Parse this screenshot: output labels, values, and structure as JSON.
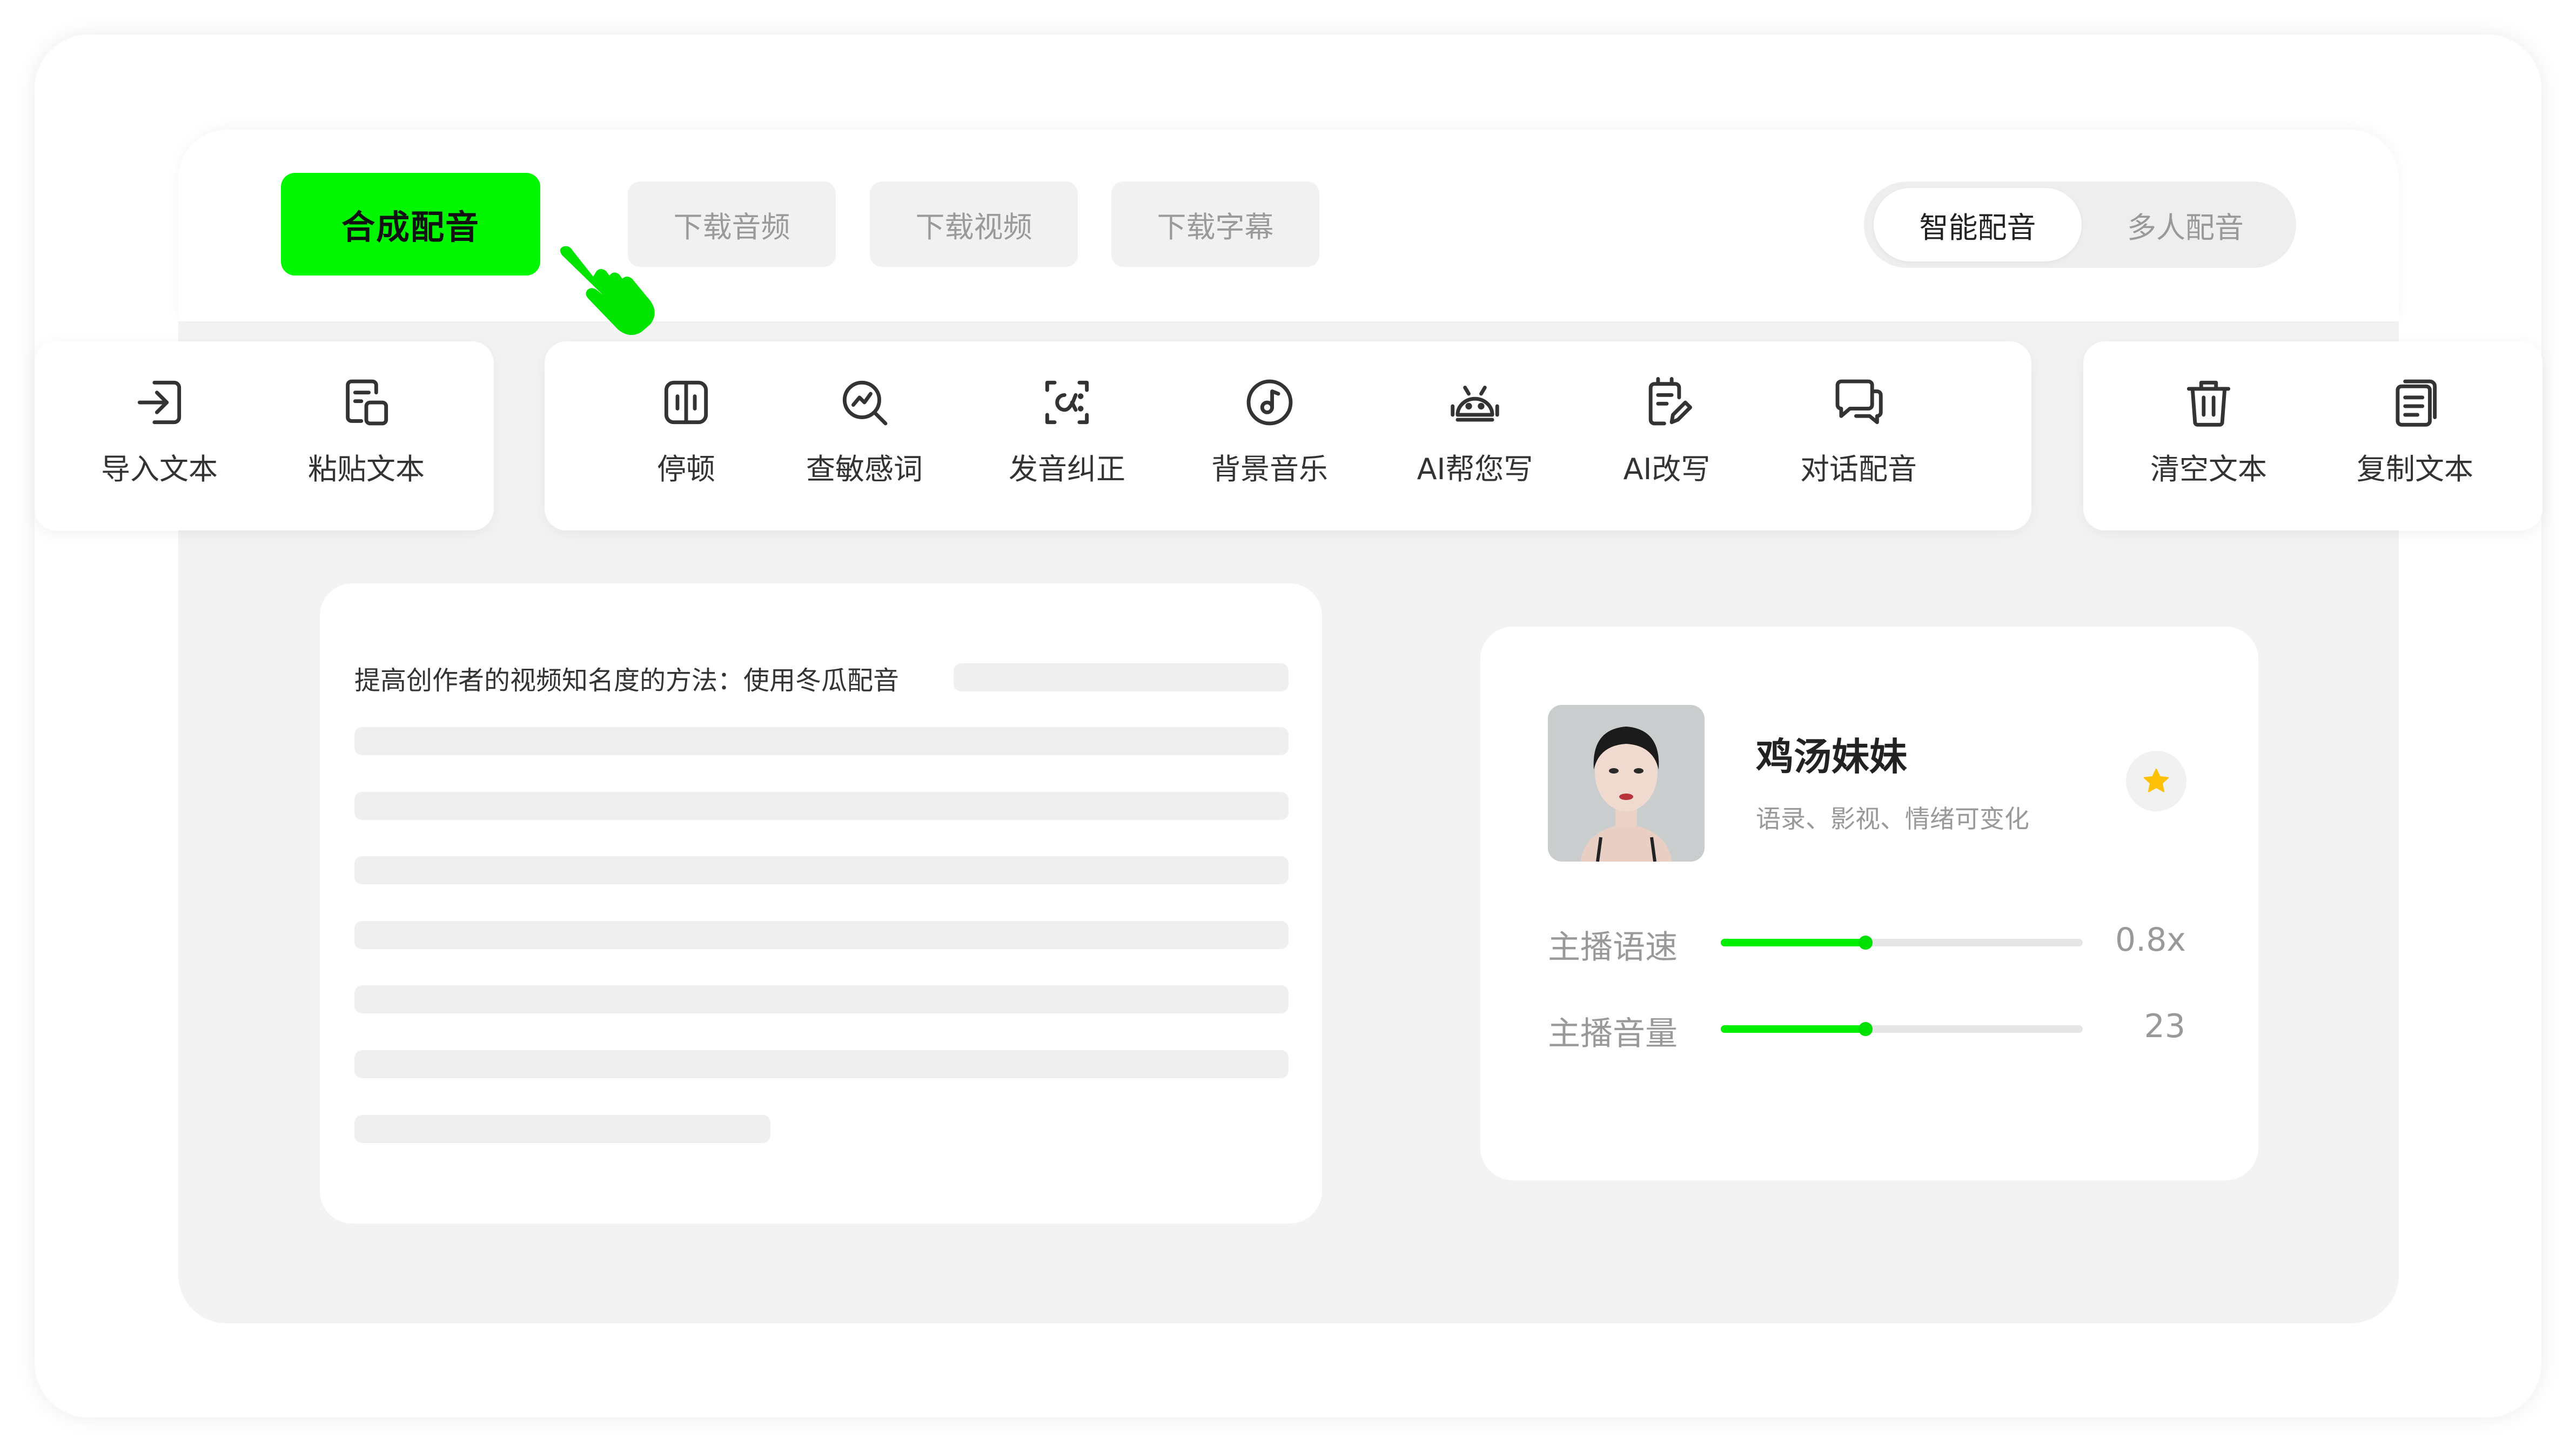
{
  "header": {
    "synthesize_label": "合成配音",
    "download_audio_label": "下载音频",
    "download_video_label": "下载视频",
    "download_subtitle_label": "下载字幕",
    "mode_tabs": [
      {
        "label": "智能配音",
        "active": true
      },
      {
        "label": "多人配音",
        "active": false
      }
    ]
  },
  "toolbar": {
    "left": [
      {
        "label": "导入文本",
        "icon": "import-icon"
      },
      {
        "label": "粘贴文本",
        "icon": "paste-icon"
      }
    ],
    "center": [
      {
        "label": "停顿",
        "icon": "pause-icon"
      },
      {
        "label": "查敏感词",
        "icon": "sensitive-check-icon"
      },
      {
        "label": "发音纠正",
        "icon": "pronunciation-icon"
      },
      {
        "label": "背景音乐",
        "icon": "music-icon"
      },
      {
        "label": "AI帮您写",
        "icon": "robot-icon"
      },
      {
        "label": "AI改写",
        "icon": "rewrite-icon"
      },
      {
        "label": "对话配音",
        "icon": "dialog-icon"
      }
    ],
    "right": [
      {
        "label": "清空文本",
        "icon": "trash-icon"
      },
      {
        "label": "复制文本",
        "icon": "copy-icon"
      }
    ]
  },
  "editor": {
    "text": "提高创作者的视频知名度的方法：使用冬瓜配音"
  },
  "voice": {
    "name": "鸡汤妹妹",
    "tags": "语录、影视、情绪可变化",
    "favorite": true,
    "params": [
      {
        "label": "主播语速",
        "value": "0.8x",
        "level": 0.4
      },
      {
        "label": "主播音量",
        "value": "23",
        "level": 0.4
      }
    ]
  },
  "colors": {
    "accent": "#00f700",
    "star": "#ffc107",
    "muted_text": "#999999",
    "panel_bg": "#f3f3f3"
  }
}
